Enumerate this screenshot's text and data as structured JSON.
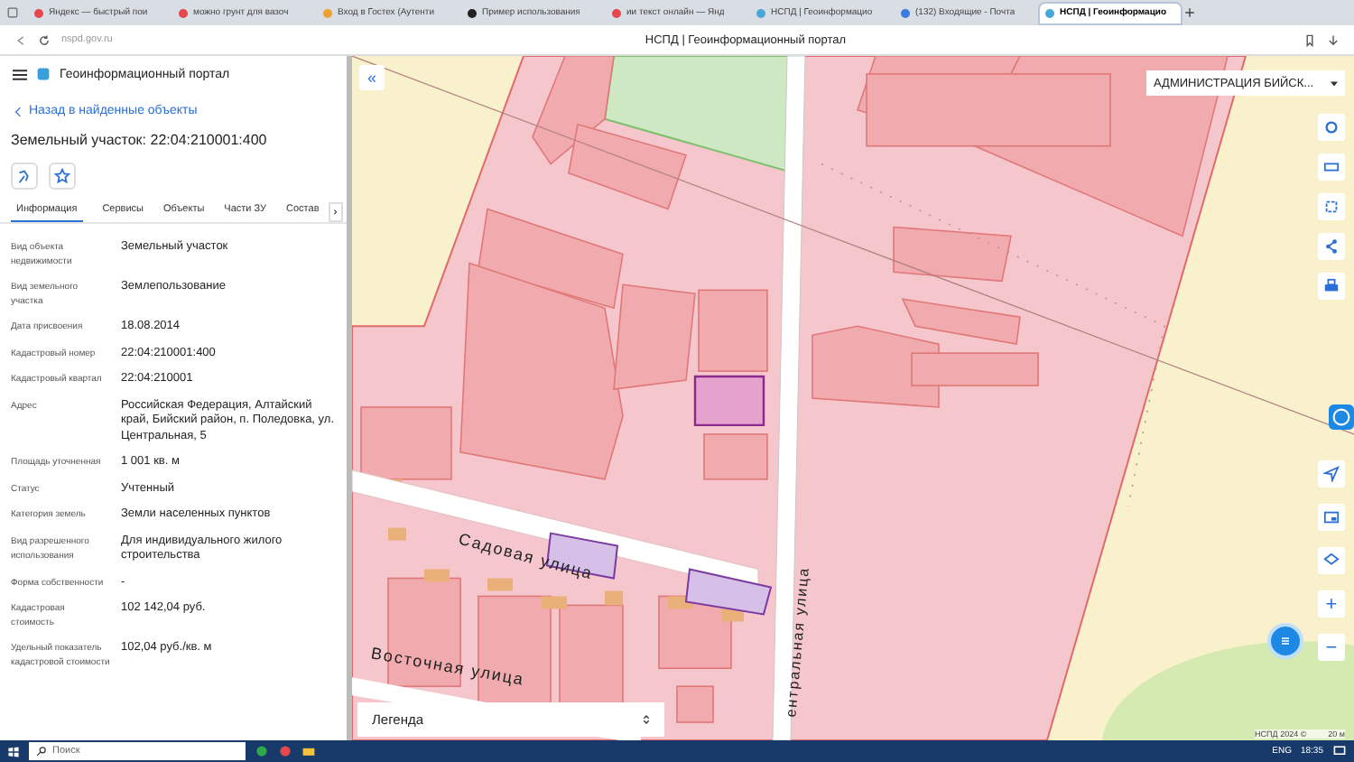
{
  "browser": {
    "tabs": [
      {
        "title": "Яндекс — быстрый пои",
        "selected": false,
        "color": "#e5484d"
      },
      {
        "title": "можно грунт для вазоч",
        "selected": false,
        "color": "#e5484d"
      },
      {
        "title": "Вход в Гостех (Аутенти",
        "selected": false,
        "color": "#f0a030"
      },
      {
        "title": "Пример использования",
        "selected": false,
        "color": "#222222"
      },
      {
        "title": "ии текст онлайн — Янд",
        "selected": false,
        "color": "#e5484d"
      },
      {
        "title": "НСПД | Геоинформацио",
        "selected": false,
        "color": "#4aa8d8"
      },
      {
        "title": "(132) Входящие - Почта",
        "selected": false,
        "color": "#3a7be0"
      },
      {
        "title": "НСПД | Геоинформацио",
        "selected": true,
        "color": "#4aa8d8"
      }
    ],
    "address": "nspd.gov.ru",
    "page_title": "НСПД | Геоинформационный портал"
  },
  "panel": {
    "portal_title": "Геоинформационный портал",
    "back_link": "Назад в найденные объекты",
    "object_title": "Земельный участок: 22:04:210001:400",
    "tabs": [
      {
        "label": "Информация",
        "selected": true
      },
      {
        "label": "Сервисы",
        "selected": false
      },
      {
        "label": "Объекты",
        "selected": false
      },
      {
        "label": "Части ЗУ",
        "selected": false
      },
      {
        "label": "Состав",
        "selected": false
      }
    ],
    "tabs_more": "›",
    "fields": [
      {
        "label": "Вид объекта недвижимости",
        "value": "Земельный участок"
      },
      {
        "label": "Вид земельного участка",
        "value": "Землепользование"
      },
      {
        "label": "Дата присвоения",
        "value": "18.08.2014"
      },
      {
        "label": "Кадастровый номер",
        "value": "22:04:210001:400"
      },
      {
        "label": "Кадастровый квартал",
        "value": "22:04:210001"
      },
      {
        "label": "Адрес",
        "value": "Российская Федерация, Алтайский край, Бийский район, п. Поледовка, ул. Центральная, 5"
      },
      {
        "label": "Площадь уточненная",
        "value": "1 001 кв. м"
      },
      {
        "label": "Статус",
        "value": "Учтенный"
      },
      {
        "label": "Категория земель",
        "value": "Земли населенных пунктов"
      },
      {
        "label": "Вид разрешенного использования",
        "value": "Для индивидуального жилого строительства"
      },
      {
        "label": "Форма собственности",
        "value": "-"
      },
      {
        "label": "Кадастровая стоимость",
        "value": "102 142,04 руб."
      },
      {
        "label": "Удельный показатель кадастровой стоимости",
        "value": "102,04 руб./кв. м"
      }
    ]
  },
  "map": {
    "collapse": "«",
    "region": "АДМИНИСТРАЦИЯ БИЙСК...",
    "streets": [
      {
        "name": "Садовая улица",
        "kind": "sadovaya"
      },
      {
        "name": "Восточная улица",
        "kind": "vostochnaya"
      },
      {
        "name": "ентральная улица",
        "kind": "central"
      }
    ],
    "zoom_in": "+",
    "zoom_out": "−",
    "legend": "Легенда",
    "attribution": "НСПД 2024 ©",
    "scale": "20 м"
  },
  "taskbar": {
    "search": "Поиск",
    "lang": "ENG",
    "time": "18:35"
  }
}
